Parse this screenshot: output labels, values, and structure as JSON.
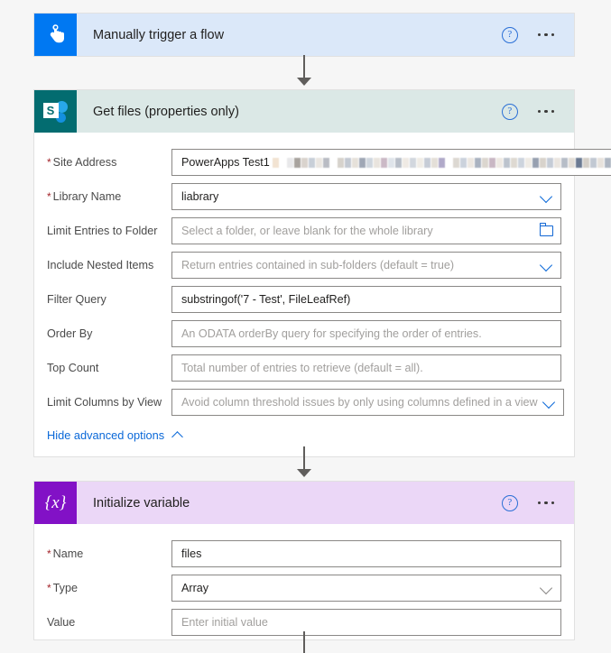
{
  "flow": {
    "trigger": {
      "title": "Manually trigger a flow",
      "icon": "tap-hand-icon",
      "help_label": "?",
      "header_color": "#dbe8f9",
      "icon_color": "#0078f2"
    },
    "get_files": {
      "title": "Get files (properties only)",
      "icon": "sharepoint-icon",
      "header_color": "#dbe8e6",
      "icon_color": "#036c70",
      "fields": [
        {
          "label": "Site Address",
          "required": true,
          "value": "PowerApps Test1",
          "redacted_suffix": true,
          "control": "dropdown"
        },
        {
          "label": "Library Name",
          "required": true,
          "value": "liabrary",
          "control": "dropdown"
        },
        {
          "label": "Limit Entries to Folder",
          "required": false,
          "placeholder": "Select a folder, or leave blank for the whole library",
          "control": "folder-picker"
        },
        {
          "label": "Include Nested Items",
          "required": false,
          "placeholder": "Return entries contained in sub-folders (default = true)",
          "control": "dropdown"
        },
        {
          "label": "Filter Query",
          "required": false,
          "value": "substringof('7 - Test', FileLeafRef)",
          "control": "text"
        },
        {
          "label": "Order By",
          "required": false,
          "placeholder": "An ODATA orderBy query for specifying the order of entries.",
          "control": "text"
        },
        {
          "label": "Top Count",
          "required": false,
          "placeholder": "Total number of entries to retrieve (default = all).",
          "control": "text"
        },
        {
          "label": "Limit Columns by View",
          "required": false,
          "placeholder": "Avoid column threshold issues by only using columns defined in a view",
          "control": "dropdown"
        }
      ],
      "advanced_toggle": "Hide advanced options"
    },
    "initialize_variable": {
      "title": "Initialize variable",
      "icon": "variable-braces-icon",
      "header_color": "#ebd7f7",
      "icon_color": "#8211c6",
      "icon_glyph": "{x}",
      "fields": [
        {
          "label": "Name",
          "required": true,
          "value": "files",
          "control": "text"
        },
        {
          "label": "Type",
          "required": true,
          "value": "Array",
          "control": "dropdown"
        },
        {
          "label": "Value",
          "required": false,
          "placeholder": "Enter initial value",
          "control": "text"
        }
      ]
    }
  },
  "redaction_colors": [
    "#f2e3d2",
    "#ffffff",
    "#e8e8ea",
    "#a8a39e",
    "#d9d3cd",
    "#c8cfd8",
    "#eae6e1",
    "#b9bcc4",
    "#ffffff",
    "#d6d2cc",
    "#c3c9d2",
    "#e6e1da",
    "#9fa7b5",
    "#cfd6de",
    "#e9e4de",
    "#cbb9c6",
    "#dfe4ea",
    "#b8bec8",
    "#efeae4",
    "#d2d7de",
    "#f0ece6",
    "#c6ccd6",
    "#e4dfd8",
    "#b0a9c9",
    "#ffffff",
    "#dcd8d2",
    "#cbd2dc",
    "#ece7e1",
    "#a9b2c0",
    "#dbd6cf",
    "#c9b7c4",
    "#eee9e3",
    "#bcc3cd",
    "#ded9d2",
    "#cdd4dd",
    "#efebe5",
    "#97a0b0",
    "#d8d3cc",
    "#c5ccd6",
    "#eae5df",
    "#b6bdc7",
    "#e2ddd6",
    "#6b7a92",
    "#d4cfc8",
    "#c1c8d2",
    "#e7e2dc",
    "#aeb6c2",
    "#dfdad3"
  ]
}
